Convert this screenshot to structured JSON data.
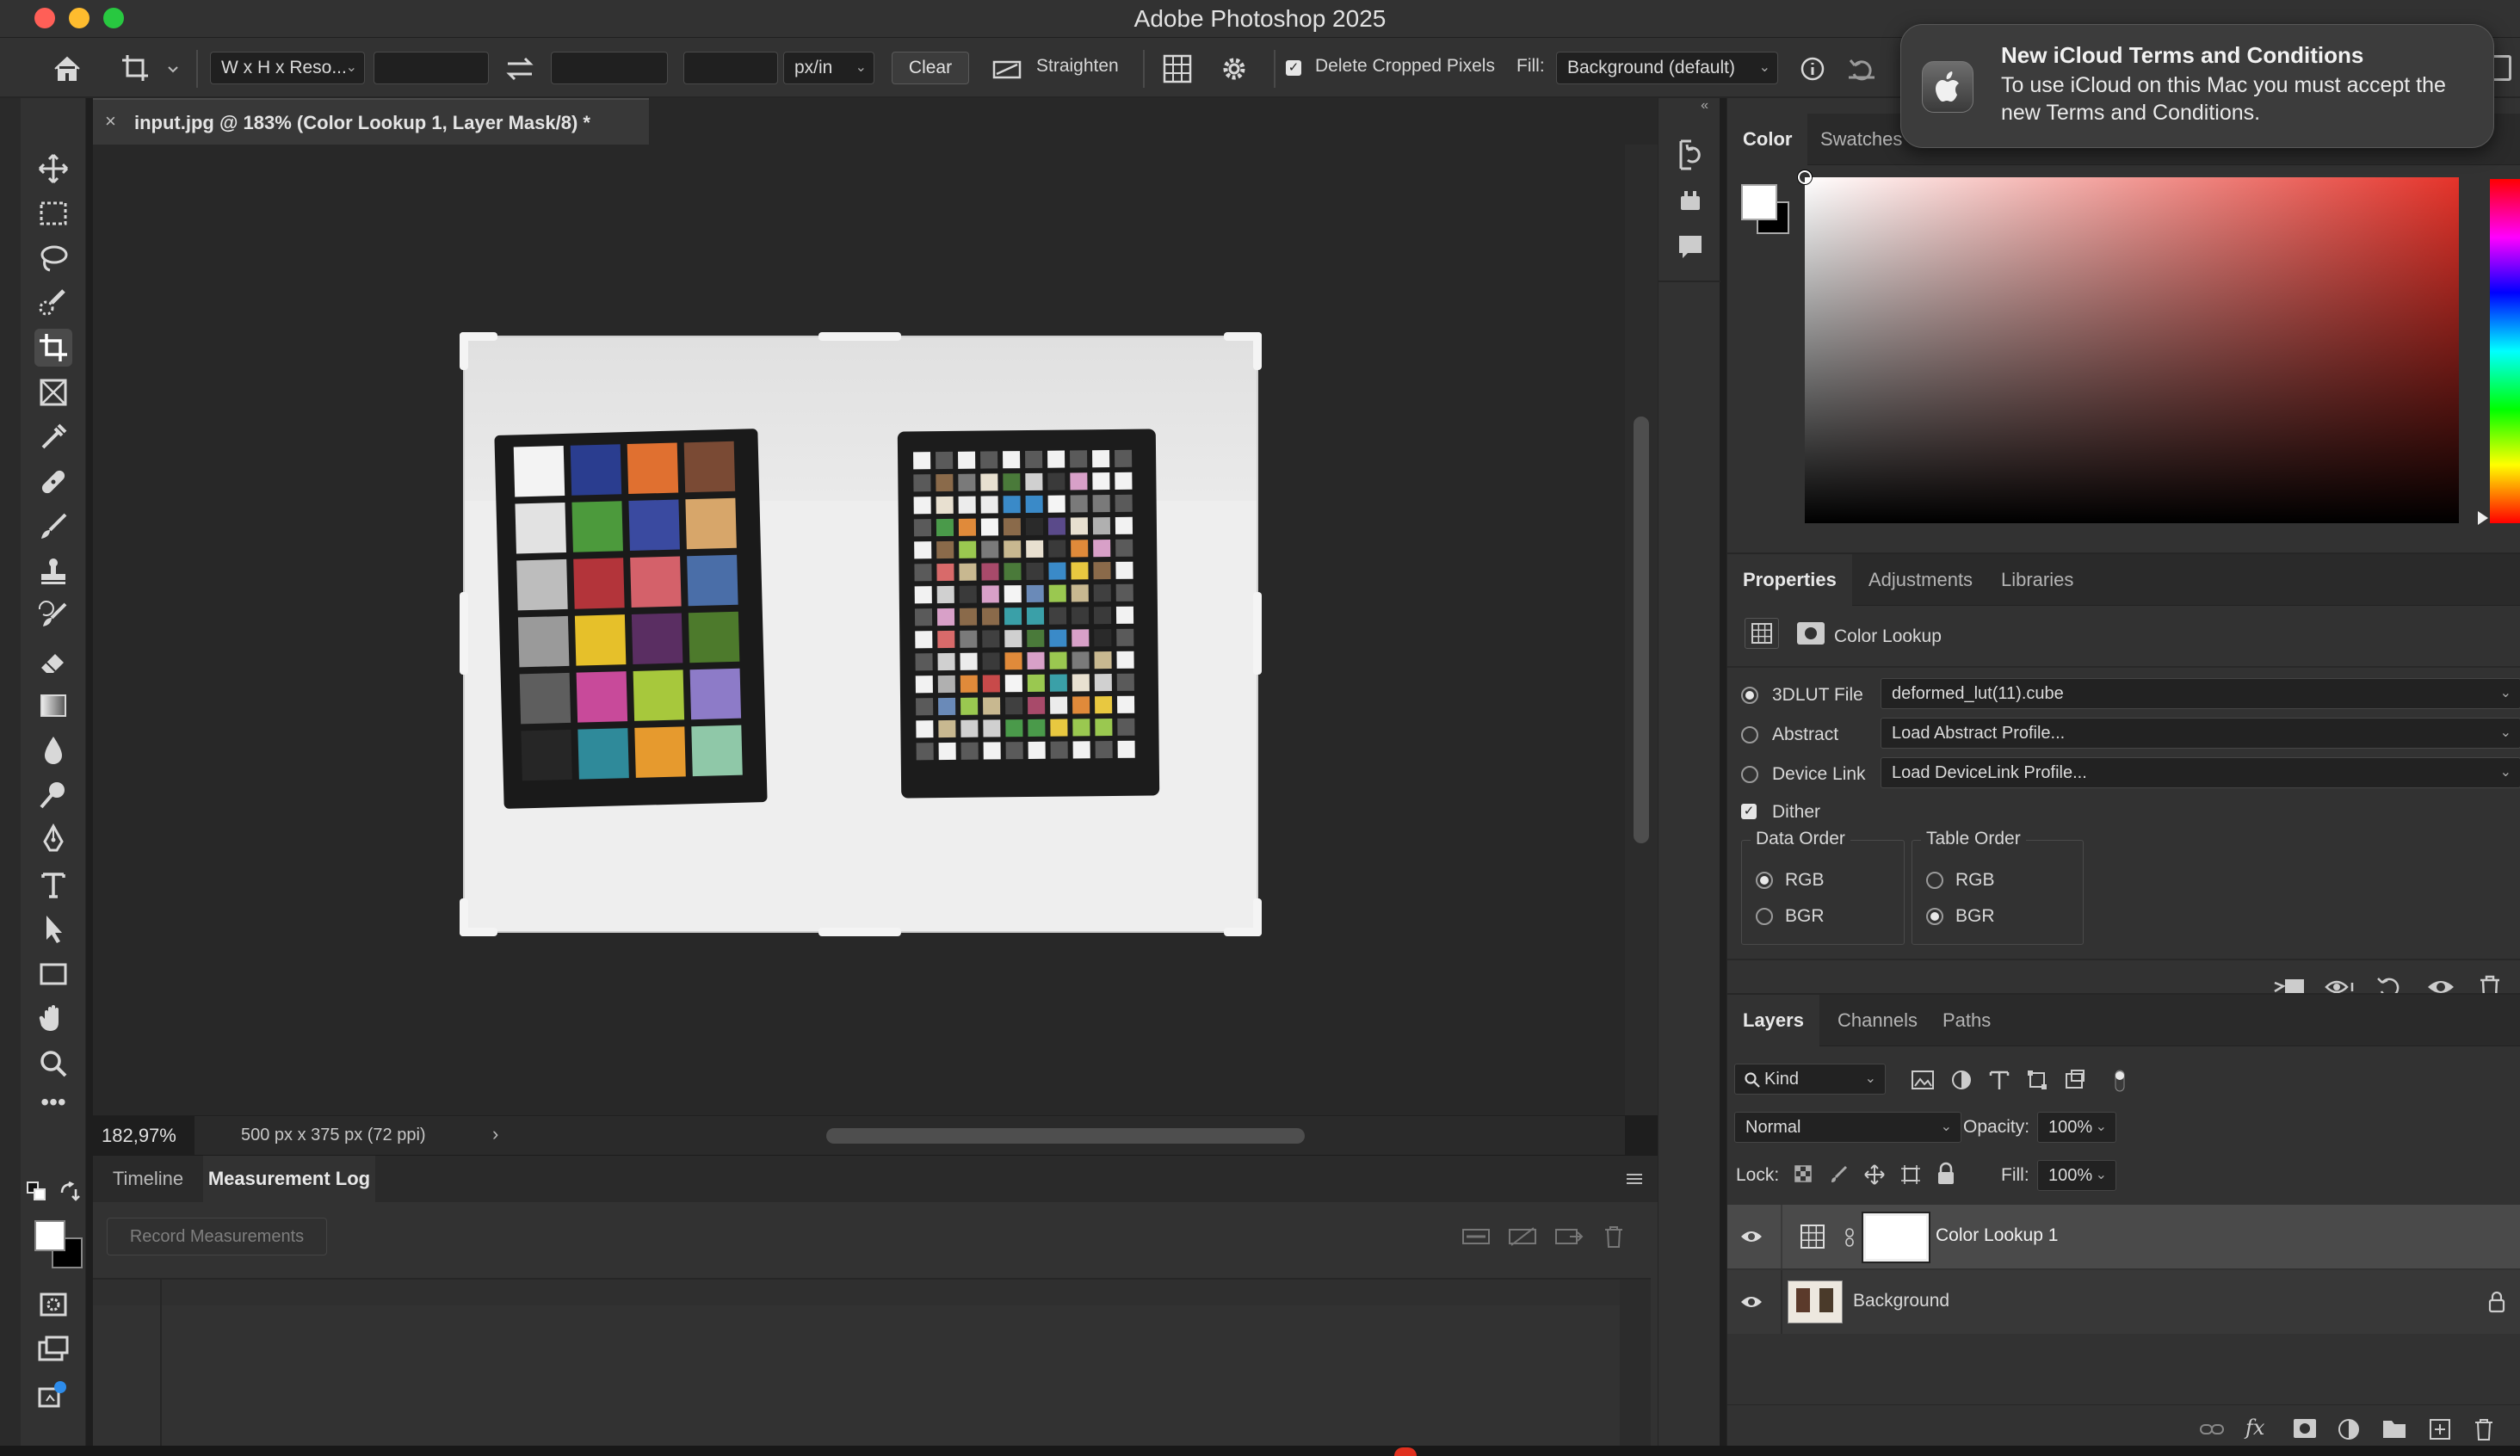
{
  "window": {
    "title": "Adobe Photoshop 2025"
  },
  "options": {
    "ratio_preset": "W x H x Reso...",
    "width_value": "",
    "height_value": "",
    "resolution_value": "",
    "units": "px/in",
    "clear": "Clear",
    "straighten": "Straighten",
    "delete_cropped_label": "Delete Cropped Pixels",
    "delete_cropped_checked": true,
    "fill_label": "Fill:",
    "fill_value": "Background (default)"
  },
  "document": {
    "tab_title": "input.jpg @ 183% (Color Lookup 1, Layer Mask/8) *",
    "zoom": "182,97%",
    "info": "500 px x 375 px (72 ppi)"
  },
  "bottom_panel": {
    "tabs": [
      "Timeline",
      "Measurement Log"
    ],
    "active_tab": "Measurement Log",
    "record_button": "Record Measurements"
  },
  "color_panel": {
    "tabs": [
      "Color",
      "Swatches"
    ],
    "active_tab": "Color",
    "hue_color": "#e5332a"
  },
  "properties": {
    "tabs": [
      "Properties",
      "Adjustments",
      "Libraries"
    ],
    "active_tab": "Properties",
    "adjustment_name": "Color Lookup",
    "rows": [
      {
        "label": "3DLUT File",
        "value": "deformed_lut(11).cube",
        "selected": true
      },
      {
        "label": "Abstract",
        "value": "Load Abstract Profile...",
        "selected": false
      },
      {
        "label": "Device Link",
        "value": "Load DeviceLink Profile...",
        "selected": false
      }
    ],
    "dither_label": "Dither",
    "dither_checked": true,
    "data_order": {
      "title": "Data Order",
      "options": [
        "RGB",
        "BGR"
      ],
      "selected": "RGB"
    },
    "table_order": {
      "title": "Table Order",
      "options": [
        "RGB",
        "BGR"
      ],
      "selected": "BGR"
    }
  },
  "layers_panel": {
    "tabs": [
      "Layers",
      "Channels",
      "Paths"
    ],
    "active_tab": "Layers",
    "filter_kind": "Kind",
    "blend_mode": "Normal",
    "opacity_label": "Opacity:",
    "opacity": "100%",
    "lock_label": "Lock:",
    "fill_label": "Fill:",
    "fill": "100%",
    "layers": [
      {
        "name": "Color Lookup 1",
        "visible": true,
        "selected": true
      },
      {
        "name": "Background",
        "visible": true,
        "locked": true
      }
    ]
  },
  "notification": {
    "title": "New iCloud Terms and Conditions",
    "body": "To use iCloud on this Mac you must accept the new Terms and Conditions."
  },
  "icons": [
    "home-icon",
    "crop-tool-icon",
    "swap-icon",
    "straighten-icon",
    "grid-overlay-icon",
    "gear-icon",
    "info-icon",
    "reset-icon",
    "move-tool-icon",
    "marquee-tool-icon",
    "lasso-tool-icon",
    "quick-selection-icon",
    "frame-tool-icon",
    "eyedropper-icon",
    "healing-brush-icon",
    "brush-icon",
    "clone-stamp-icon",
    "history-brush-icon",
    "eraser-icon",
    "gradient-icon",
    "blur-icon",
    "dodge-icon",
    "pen-icon",
    "type-icon",
    "path-selection-icon",
    "rectangle-icon",
    "hand-icon",
    "zoom-icon",
    "more-tools-icon",
    "history-panel-icon",
    "plugins-icon",
    "comments-icon",
    "apple-logo-icon",
    "eye-icon",
    "lock-icon",
    "link-icon",
    "trash-icon"
  ]
}
